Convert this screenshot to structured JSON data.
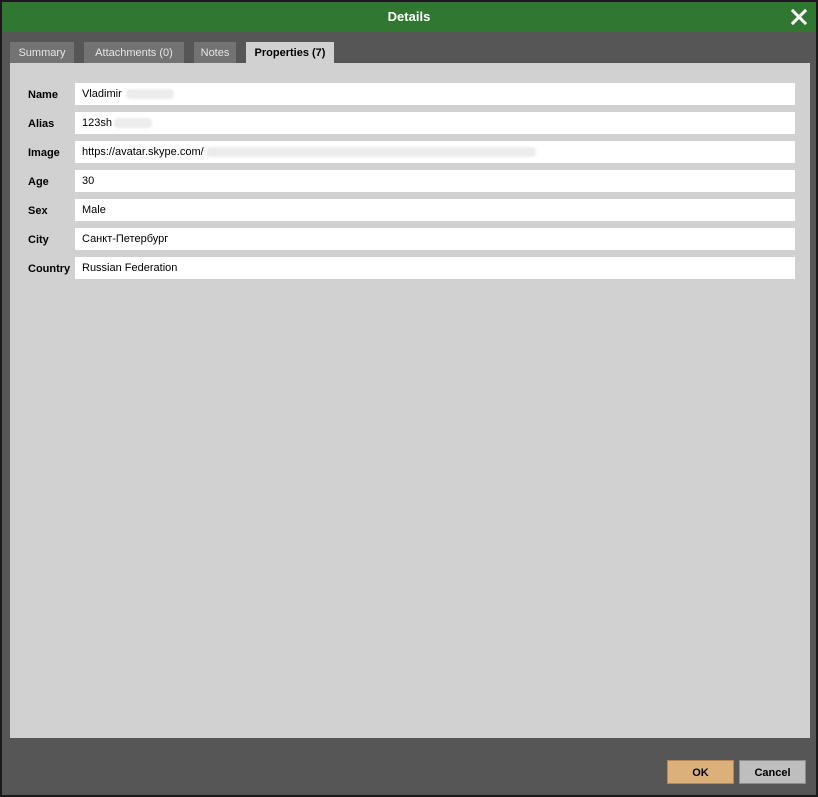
{
  "window": {
    "title": "Details",
    "accent_color": "#307831",
    "close_icon": "close-icon"
  },
  "tabs": [
    {
      "label": "Summary",
      "active": false
    },
    {
      "label": "Attachments (0)",
      "active": false
    },
    {
      "label": "Notes",
      "active": false
    },
    {
      "label": "Properties (7)",
      "active": true
    }
  ],
  "properties": [
    {
      "label": "Name",
      "value": "Vladimir"
    },
    {
      "label": "Alias",
      "value": "123sh"
    },
    {
      "label": "Image",
      "value": "https://avatar.skype.com/"
    },
    {
      "label": "Age",
      "value": "30"
    },
    {
      "label": "Sex",
      "value": "Male"
    },
    {
      "label": "City",
      "value": "Санкт-Петербург"
    },
    {
      "label": "Country",
      "value": "Russian Federation"
    }
  ],
  "buttons": {
    "ok_label": "OK",
    "cancel_label": "Cancel",
    "ok_color": "#dcb179"
  }
}
